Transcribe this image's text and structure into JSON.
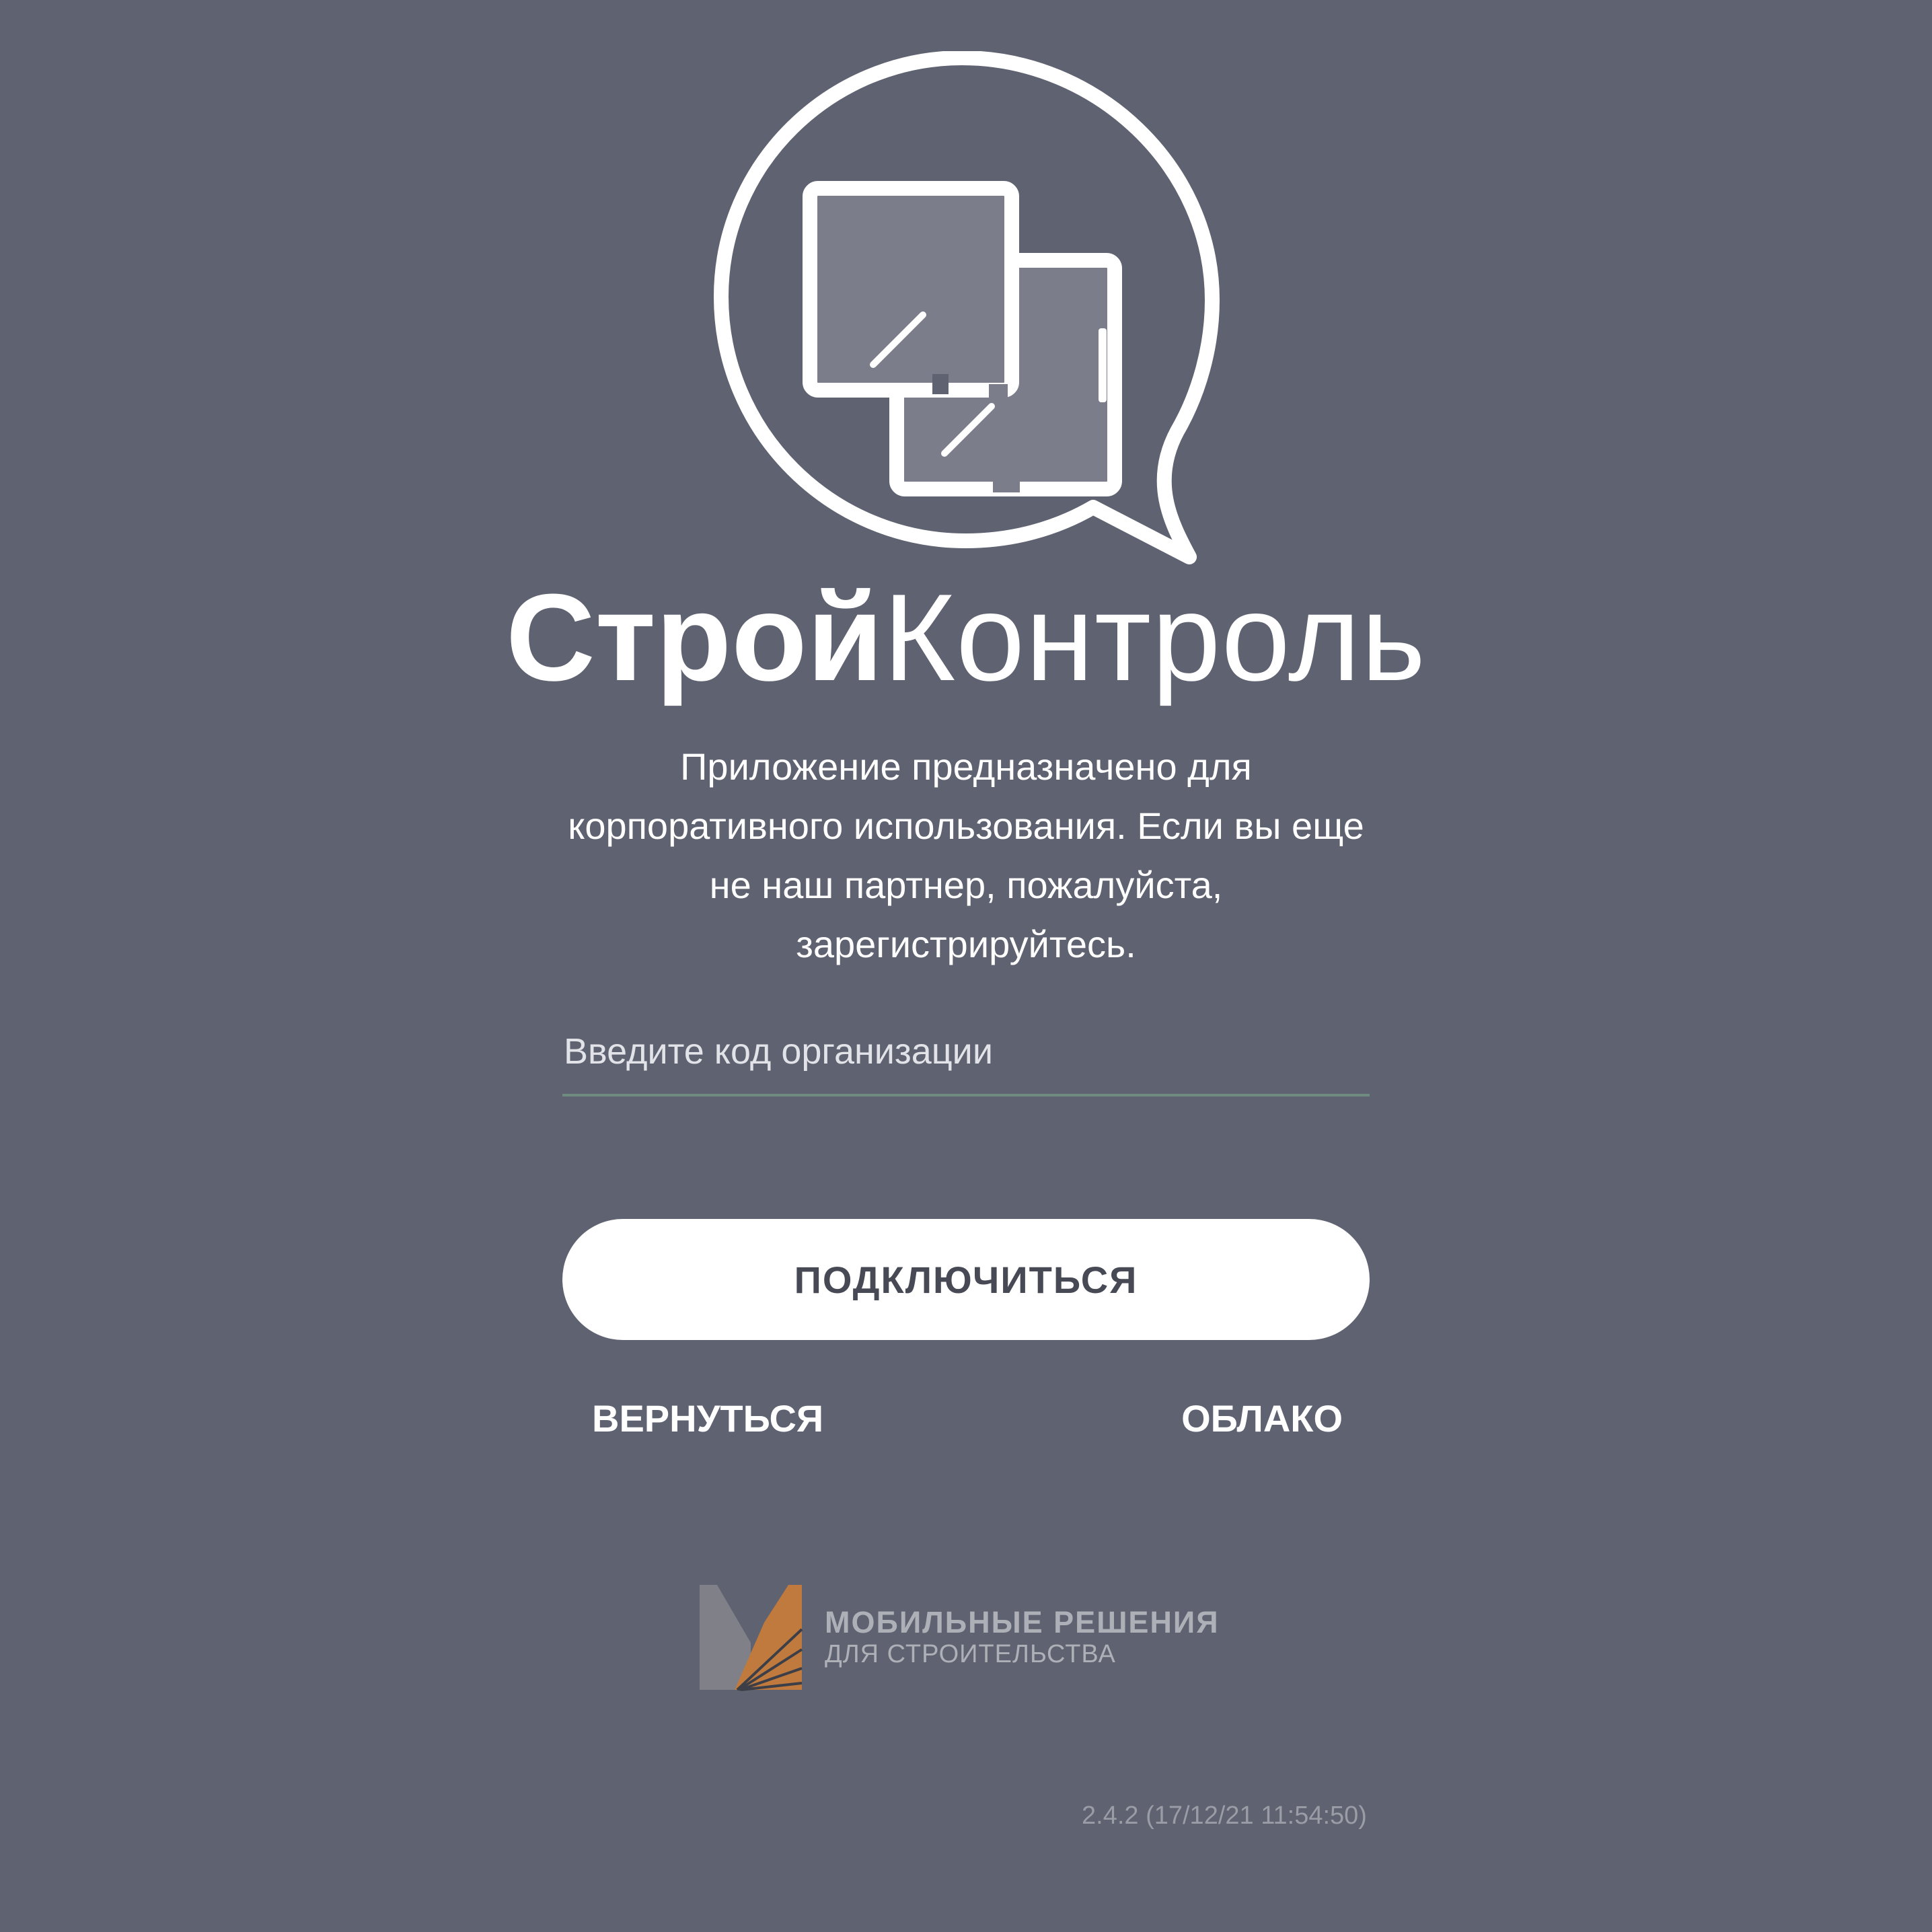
{
  "app": {
    "brand_bold": "Строй",
    "brand_light": "Контроль",
    "logo_icon": "chat-bubble-devices-icon"
  },
  "description": "Приложение предназначено для корпоративного использования. Если вы еще не наш партнер, пожалуйста, зарегистрируйтесь.",
  "form": {
    "org_code_placeholder": "Введите код организации",
    "org_code_value": "",
    "connect_label": "ПОДКЛЮЧИТЬСЯ"
  },
  "links": {
    "back_label": "ВЕРНУТЬСЯ",
    "cloud_label": "ОБЛАКО"
  },
  "vendor": {
    "name": "МОБИЛЬНЫЕ РЕШЕНИЯ",
    "subtitle": "ДЛЯ СТРОИТЕЛЬСТВА",
    "logo_icon": "m-letter-logo-icon"
  },
  "version": "2.4.2 (17/12/21 11:54:50)",
  "colors": {
    "background": "#5f6270",
    "primary_text": "#ffffff",
    "button_bg": "#ffffff",
    "button_text": "#474a55",
    "input_underline": "#6f8a7e",
    "vendor_orange": "#c07a3d",
    "vendor_gray": "#8c8c8c",
    "muted_text": "#9a9ca6"
  }
}
